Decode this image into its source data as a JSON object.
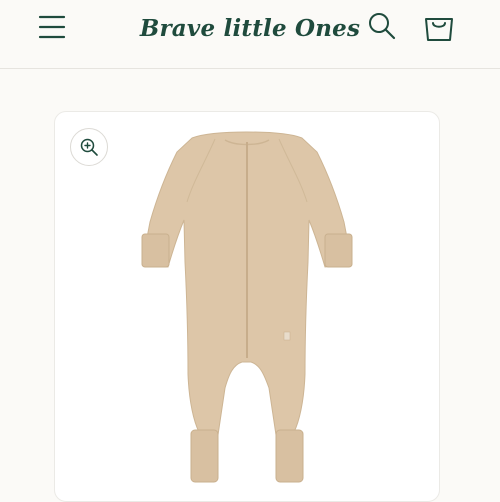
{
  "header": {
    "brand_name": "Brave little Ones",
    "menu_icon": "hamburger-menu-icon",
    "search_icon": "search-icon",
    "cart_icon": "shopping-bag-icon"
  },
  "product": {
    "image_subject": "beige zip-up baby sleepsuit",
    "zoom_icon": "zoom-in-icon"
  },
  "colors": {
    "brand": "#1f4b3d",
    "background": "#fbfaf7",
    "garment": "#ddc6a8"
  }
}
